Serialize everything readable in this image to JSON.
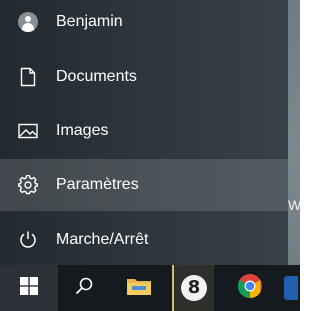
{
  "start_menu": {
    "user": {
      "name": "Benjamin",
      "icon": "user-avatar-icon"
    },
    "items": [
      {
        "label": "Documents",
        "icon": "document-icon"
      },
      {
        "label": "Images",
        "icon": "image-icon"
      },
      {
        "label": "Paramètres",
        "icon": "gear-icon",
        "highlighted": true
      },
      {
        "label": "Marche/Arrêt",
        "icon": "power-icon"
      }
    ]
  },
  "taskbar": {
    "buttons": [
      {
        "name": "start",
        "icon": "windows-logo-icon"
      },
      {
        "name": "search",
        "icon": "search-icon"
      },
      {
        "name": "file-explorer",
        "icon": "folder-icon"
      },
      {
        "name": "pinned-app",
        "icon": "eight-badge-icon",
        "text": "8",
        "active": true
      },
      {
        "name": "chrome",
        "icon": "chrome-icon"
      },
      {
        "name": "partial-app",
        "icon": "app-icon"
      }
    ]
  },
  "desktop": {
    "edge_text": "W"
  },
  "colors": {
    "menu_bg": "#2b343a",
    "highlight": "#4a5257",
    "taskbar_bg": "#141a1e",
    "active_indicator": "#c9c46a"
  }
}
